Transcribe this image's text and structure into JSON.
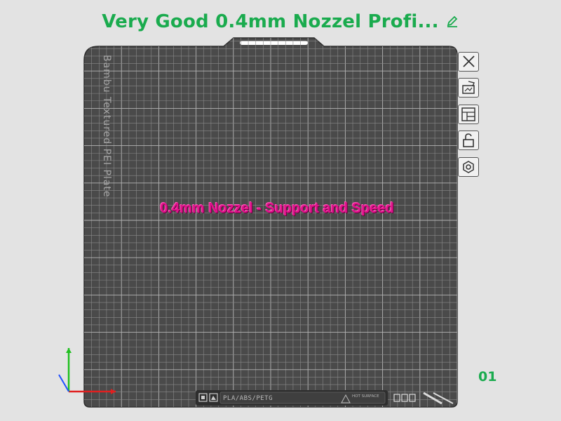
{
  "header": {
    "plate_name": "Very Good 0.4mm Nozzel Profi...",
    "edit_icon": "pencil-icon"
  },
  "plate": {
    "type_label": "Bambu Textured PEI Plate",
    "overlay_text": "0.4mm Nozzel - Support and Speed",
    "index": "01",
    "filament_label": "PLA/ABS/PETG",
    "warning_label": "HOT SURFACE",
    "overlay_color": "#e0138c",
    "accent_color": "#1aab4e",
    "bed_color": "#4a4a4a"
  },
  "toolbar": {
    "items": [
      {
        "icon": "close-icon"
      },
      {
        "icon": "auto-orient-icon"
      },
      {
        "icon": "arrange-icon"
      },
      {
        "icon": "lock-icon"
      },
      {
        "icon": "plate-settings-icon"
      }
    ]
  },
  "axes": {
    "x_color": "#e02020",
    "y_color": "#20c020",
    "z_color": "#2050ff"
  }
}
